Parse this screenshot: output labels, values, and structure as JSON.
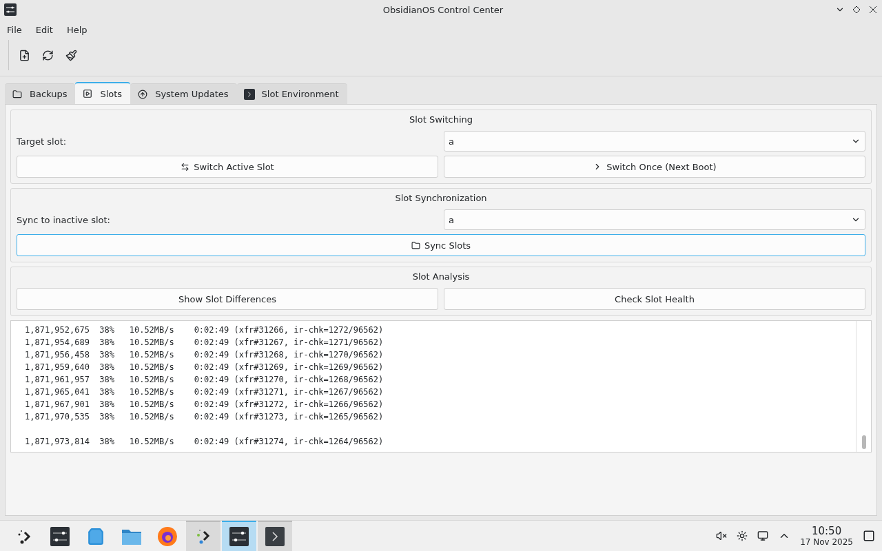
{
  "window": {
    "title": "ObsidianOS Control Center"
  },
  "menu": [
    "File",
    "Edit",
    "Help"
  ],
  "toolbar": [
    {
      "kind": "new"
    },
    {
      "kind": "refresh"
    },
    {
      "kind": "clean"
    }
  ],
  "tabs": [
    {
      "label": "Backups",
      "kind": "folder",
      "selected": false
    },
    {
      "label": "Slots",
      "kind": "slot",
      "selected": true
    },
    {
      "label": "System Updates",
      "kind": "update",
      "selected": false
    },
    {
      "label": "Slot Environment",
      "kind": "terminal",
      "selected": false
    }
  ],
  "groups": [
    {
      "title": "Slot Switching",
      "field": {
        "label": "Target slot:",
        "value": "a"
      },
      "buttons": [
        {
          "label": "Switch Active Slot",
          "kind": "switch",
          "focused": false
        },
        {
          "label": "Switch Once (Next Boot)",
          "kind": "chevron",
          "focused": false
        }
      ]
    },
    {
      "title": "Slot Synchronization",
      "field": {
        "label": "Sync to inactive slot:",
        "value": "a"
      },
      "buttons": [
        {
          "label": "Sync Slots",
          "kind": "folder",
          "focused": true
        }
      ]
    },
    {
      "title": "Slot Analysis",
      "buttons": [
        {
          "label": "Show Slot Differences",
          "focused": false
        },
        {
          "label": "Check Slot Health",
          "focused": false
        }
      ]
    }
  ],
  "log_blocks": [
    [
      "1,871,952,675  38%   10.52MB/s    0:02:49 (xfr#31266, ir-chk=1272/96562)",
      "1,871,954,689  38%   10.52MB/s    0:02:49 (xfr#31267, ir-chk=1271/96562)",
      "1,871,956,458  38%   10.52MB/s    0:02:49 (xfr#31268, ir-chk=1270/96562)",
      "1,871,959,640  38%   10.52MB/s    0:02:49 (xfr#31269, ir-chk=1269/96562)",
      "1,871,961,957  38%   10.52MB/s    0:02:49 (xfr#31270, ir-chk=1268/96562)",
      "1,871,965,041  38%   10.52MB/s    0:02:49 (xfr#31271, ir-chk=1267/96562)",
      "1,871,967,901  38%   10.52MB/s    0:02:49 (xfr#31272, ir-chk=1266/96562)",
      "1,871,970,535  38%   10.52MB/s    0:02:49 (xfr#31273, ir-chk=1265/96562)"
    ],
    [
      "1,871,973,814  38%   10.52MB/s    0:02:49 (xfr#31274, ir-chk=1264/96562)"
    ]
  ],
  "taskbar": {
    "apps": [
      {
        "kind": "launcher",
        "open": false,
        "selected": false
      },
      {
        "kind": "control",
        "open": false,
        "selected": false
      },
      {
        "kind": "store",
        "open": false,
        "selected": false
      },
      {
        "kind": "files",
        "open": false,
        "selected": false
      },
      {
        "kind": "browser",
        "open": false,
        "selected": false
      },
      {
        "kind": "launcher2",
        "open": true,
        "selected": false
      },
      {
        "kind": "control",
        "open": true,
        "selected": true
      },
      {
        "kind": "terminal",
        "open": true,
        "selected": false
      }
    ],
    "tray": [
      {
        "kind": "muted"
      },
      {
        "kind": "brightness"
      },
      {
        "kind": "network"
      },
      {
        "kind": "expand"
      }
    ],
    "time": "10:50",
    "date": "17 Nov 2025"
  }
}
